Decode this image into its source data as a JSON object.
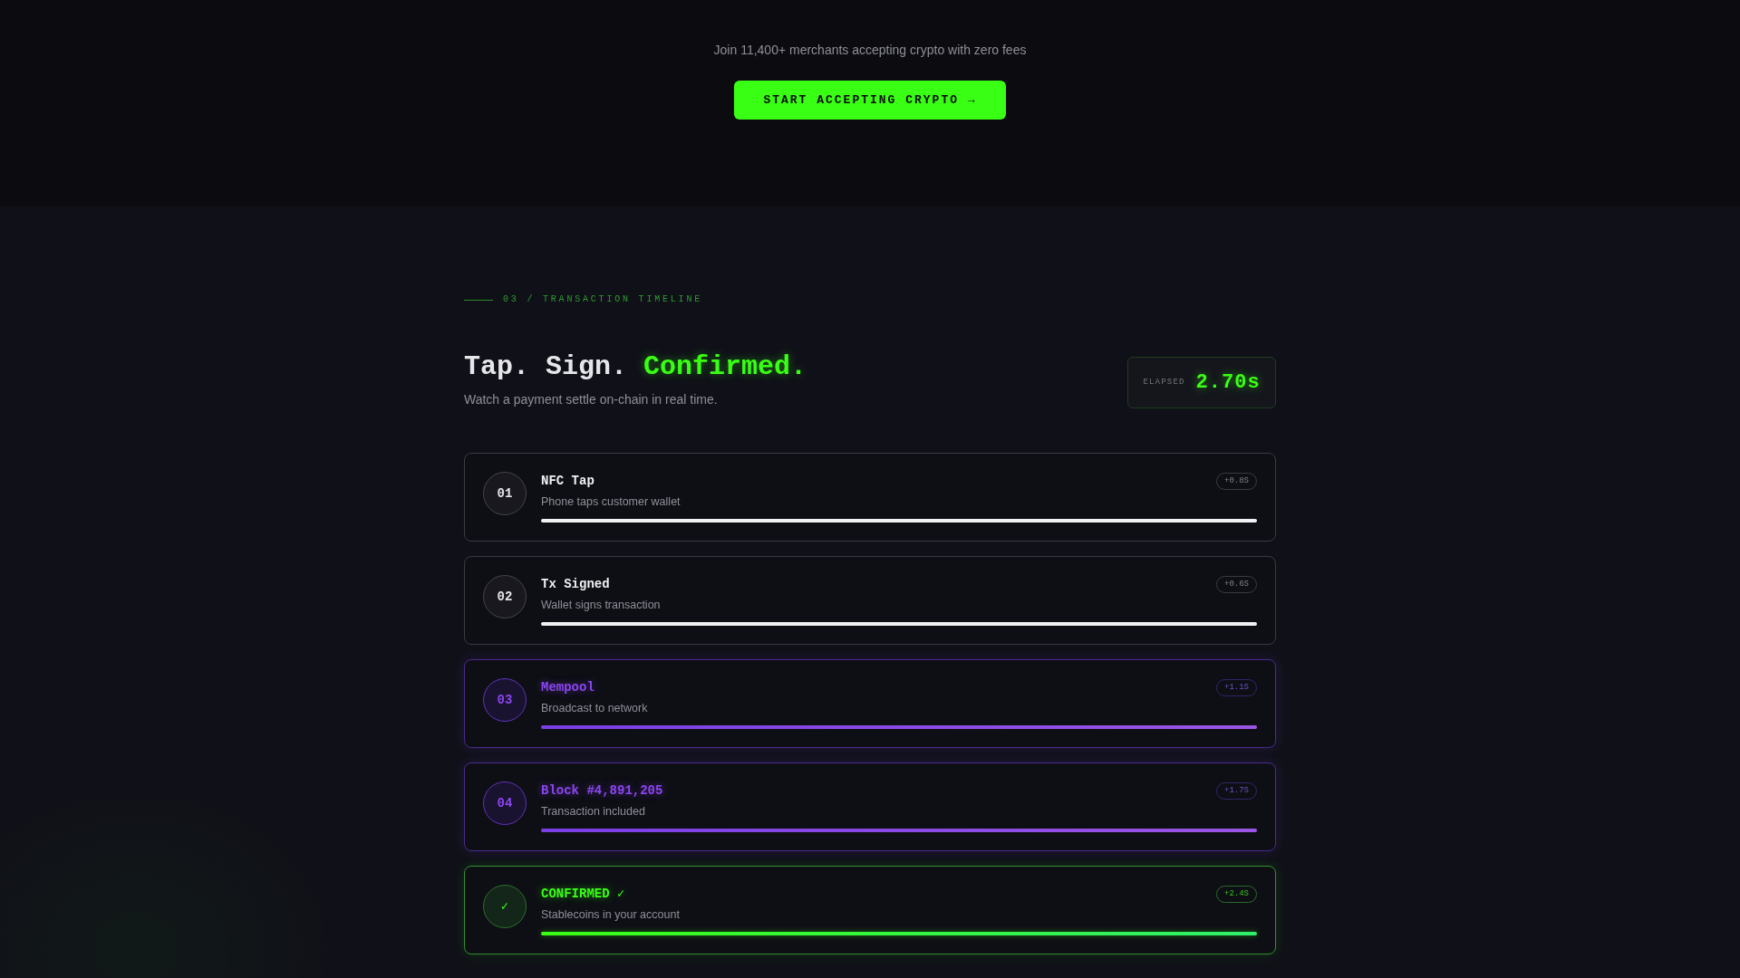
{
  "cta_section": {
    "tagline": "Join 11,400+ merchants accepting crypto with zero fees",
    "button": "START ACCEPTING CRYPTO →"
  },
  "timeline_section": {
    "eyebrow": "03 / TRANSACTION TIMELINE",
    "heading": {
      "lead": "Tap. Sign.",
      "highlight": "Confirmed."
    },
    "subtitle": "Watch a payment settle on-chain in real time.",
    "elapsed": {
      "label": "ELAPSED",
      "value": "2.70s"
    },
    "steps": [
      {
        "kind": "complete",
        "marker": "01",
        "title": "NFC Tap",
        "description": "Phone taps customer wallet",
        "time": "+0.8S",
        "level": 1
      },
      {
        "kind": "complete",
        "marker": "02",
        "title": "Tx Signed",
        "description": "Wallet signs transaction",
        "time": "+0.6S",
        "level": 1
      },
      {
        "kind": "processing",
        "marker": "03",
        "title": "Mempool",
        "description": "Broadcast to network",
        "time": "+1.1S",
        "level": 1
      },
      {
        "kind": "processing",
        "marker": "04",
        "title": "Block #4,891,205",
        "description": "Transaction included",
        "time": "+1.7S",
        "level": 1
      },
      {
        "kind": "confirmed",
        "marker": "✓",
        "title": "CONFIRMED ✓",
        "description": "Stablecoins in your account",
        "time": "+2.4S",
        "level": 1
      }
    ]
  }
}
